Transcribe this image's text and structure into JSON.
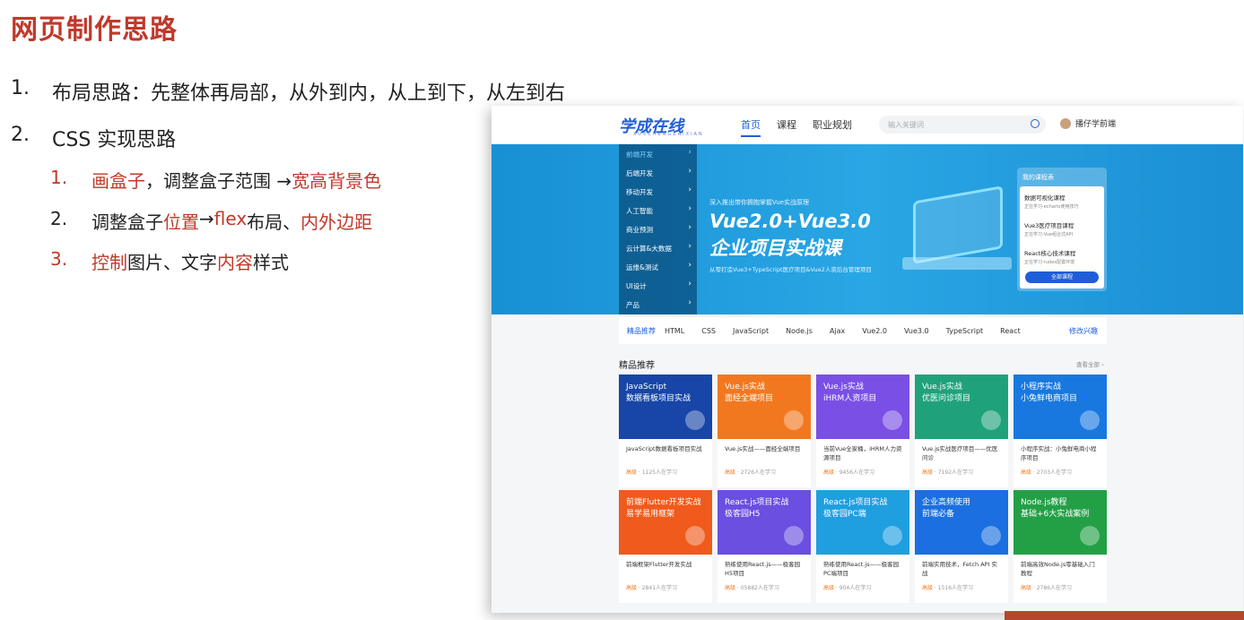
{
  "slide": {
    "title": "网页制作思路",
    "points": [
      {
        "num": "1.",
        "text": "布局思路：先整体再局部，从外到内，从上到下，从左到右"
      },
      {
        "num": "2.",
        "text": "CSS 实现思路"
      }
    ],
    "subpoints": {
      "s1": {
        "num": "1.",
        "a": "画盒子",
        "b": "，调整盒子范围 → ",
        "c": "宽高背景色"
      },
      "s2": {
        "num": "2.",
        "a": "调整盒子",
        "b": "位置",
        "c": " → ",
        "d": "flex",
        "e": " 布局、",
        "f": "内外边距"
      },
      "s3": {
        "num": "3.",
        "a": "控制",
        "b": "图片、文字",
        "c": "内容",
        "d": "样式"
      }
    }
  },
  "site": {
    "logo": "学成在线",
    "logo_sub": "XUECHENGZAIXIAN",
    "nav": [
      "首页",
      "课程",
      "职业规划"
    ],
    "search_placeholder": "输入关键词",
    "user": "播仔学前端",
    "side_menu": [
      "前端开发",
      "后端开发",
      "移动开发",
      "人工智能",
      "商业预测",
      "云计算&大数据",
      "运维&测试",
      "UI设计",
      "产品"
    ],
    "banner": {
      "promo": "深入推出带你拥抱掌握Vue实战原理",
      "line1": "Vue2.0+Vue3.0",
      "line2": "企业项目实战课",
      "sub": "从零打造Vue3+TypeScript医疗项目&Vue2人资后台管理项目"
    },
    "course_box": {
      "title": "我的课程表",
      "items": [
        {
          "t": "数据可视化课程",
          "s": "正在学习-echarts使用技巧"
        },
        {
          "t": "Vue3医疗项目课程",
          "s": "正在学习-Vue组合式API"
        },
        {
          "t": "React核心技术课程",
          "s": "正在学习-rudex配置环境"
        }
      ],
      "button": "全部课程"
    },
    "tags": {
      "lead": "精品推荐",
      "items": [
        "HTML",
        "CSS",
        "JavaScript",
        "Node.js",
        "Ajax",
        "Vue2.0",
        "Vue3.0",
        "TypeScript",
        "React"
      ],
      "more": "修改兴趣"
    },
    "section": {
      "title": "精品推荐",
      "more": "查看全部 ›"
    },
    "cards": [
      {
        "img1": "JavaScript",
        "img2": "数据看板项目实战",
        "desc": "JavaScript数据看板项目实战",
        "lvl": "高级",
        "count": " · 1125人在学习",
        "color": "#1746a8"
      },
      {
        "img1": "Vue.js实战",
        "img2": "面经全端项目",
        "desc": "Vue.js实战——面经全端项目",
        "lvl": "高级",
        "count": " · 2726人在学习",
        "color": "#f2781f"
      },
      {
        "img1": "Vue.js实战",
        "img2": "iHRM人资项目",
        "desc": "当前Vue全家桶，iHRM人力资源项目",
        "lvl": "高级",
        "count": " · 9456人在学习",
        "color": "#7a4fe6"
      },
      {
        "img1": "Vue.js实战",
        "img2": "优医问诊项目",
        "desc": "Vue.js实战医疗项目——优医问诊",
        "lvl": "高级",
        "count": " · 7192人在学习",
        "color": "#1fa27c"
      },
      {
        "img1": "小程序实战",
        "img2": "小兔鲜电商项目",
        "desc": "小程序实战：小兔鲜电商小程序项目",
        "lvl": "高级",
        "count": " · 2703人在学习",
        "color": "#1878e0"
      },
      {
        "img1": "前端Flutter开发实战",
        "img2": "易学易用框架",
        "desc": "前端框架Flutter开发实战",
        "lvl": "高级",
        "count": " · 2841人在学习",
        "color": "#f05a1c"
      },
      {
        "img1": "React.js项目实战",
        "img2": "极客园H5",
        "desc": "熟练使用React.js——极客园H5项目",
        "lvl": "高级",
        "count": " · 05882人在学习",
        "color": "#6a4fe0"
      },
      {
        "img1": "React.js项目实战",
        "img2": "极客园PC端",
        "desc": "熟练使用React.js——极客园PC端项目",
        "lvl": "高级",
        "count": " · 904人在学习",
        "color": "#1f9fe0"
      },
      {
        "img1": "企业高频使用",
        "img2": "前端必备",
        "desc": "前端实用技术，Fetch API 实战",
        "lvl": "高级",
        "count": " · 1516人在学习",
        "color": "#1b6fe0"
      },
      {
        "img1": "Node.js教程",
        "img2": "基础+6大实战案例",
        "desc": "前端高效Node.js零基础入门教程",
        "lvl": "高级",
        "count": " · 2786人在学习",
        "color": "#23a046"
      }
    ]
  }
}
